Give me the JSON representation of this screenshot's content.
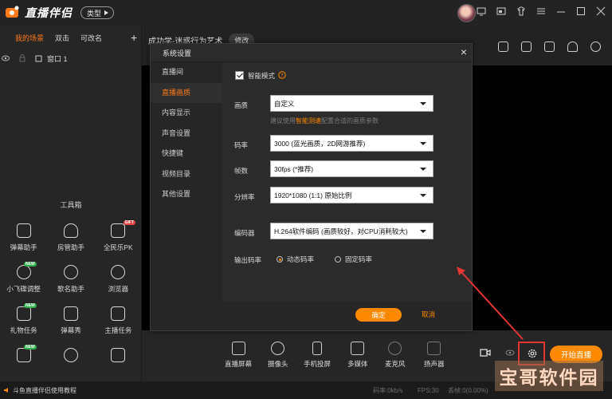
{
  "app": {
    "logo_text": "直播伴侣",
    "type_button": "类型"
  },
  "scenes": {
    "tabs": [
      "我的场景",
      "双击",
      "可改名"
    ],
    "add_label": "+",
    "source_item": "窗口 1"
  },
  "stream": {
    "title": "成功学-迷惑行为艺术",
    "edit_label": "修改"
  },
  "toolbox": {
    "title": "工具箱",
    "items": [
      {
        "label": "弹幕助手",
        "icon": "comment-box-icon",
        "badge": ""
      },
      {
        "label": "房管助手",
        "icon": "user-shield-icon",
        "badge": ""
      },
      {
        "label": "全民乐PK",
        "icon": "pk-icon",
        "badge": "GIFT"
      },
      {
        "label": "小飞碟调整",
        "icon": "ufo-icon",
        "badge": "NEW"
      },
      {
        "label": "歌名助手",
        "icon": "music-note-icon",
        "badge": ""
      },
      {
        "label": "浏览器",
        "icon": "compass-icon",
        "badge": ""
      },
      {
        "label": "礼物任务",
        "icon": "gift-task-icon",
        "badge": "NEW"
      },
      {
        "label": "弹幕秀",
        "icon": "tv-icon",
        "badge": ""
      },
      {
        "label": "主播任务",
        "icon": "checklist-icon",
        "badge": ""
      },
      {
        "label": "",
        "icon": "wand-icon",
        "badge": "NEW"
      },
      {
        "label": "",
        "icon": "fff-icon",
        "badge": ""
      },
      {
        "label": "",
        "icon": "pk-icon",
        "badge": ""
      }
    ]
  },
  "dialog": {
    "title": "系统设置",
    "close": "×",
    "nav": [
      "直播间",
      "直播画质",
      "内容显示",
      "声音设置",
      "快捷键",
      "视频目录",
      "其他设置"
    ],
    "nav_selected": 1,
    "smart_mode_label": "智能模式",
    "quality_label": "画质",
    "quality_value": "自定义",
    "hint_prefix": "建议使用",
    "hint_link": "智能测速",
    "hint_suffix": "配置合适的画质参数",
    "bitrate_label": "码率",
    "bitrate_value": "3000 (蓝光画质，2D网游推荐)",
    "fps_label": "帧数",
    "fps_value": "30fps (*推荐)",
    "resolution_label": "分辨率",
    "resolution_value": "1920*1080 (1:1) 原始比例",
    "encoder_label": "编码器",
    "encoder_value": "H.264软件编码 (画质较好，对CPU消耗较大)",
    "output_label": "输出码率",
    "radio_dynamic": "动态码率",
    "radio_fixed": "固定码率",
    "ok": "确定",
    "cancel": "取消"
  },
  "bottom_toolbar": {
    "items": [
      "直播屏幕",
      "摄像头",
      "手机投屏",
      "多媒体",
      "麦克风",
      "扬声器"
    ],
    "start_button": "开始直播"
  },
  "status": {
    "tutorial": "斗鱼直播伴侣使用教程",
    "bitrate": "码率:0kb/s",
    "fps": "FPS:30",
    "dropped": "丢帧:0(0.00%)"
  },
  "watermark": "宝哥软件园",
  "colors": {
    "accent": "#ff8a00",
    "annotation": "#e53535"
  }
}
